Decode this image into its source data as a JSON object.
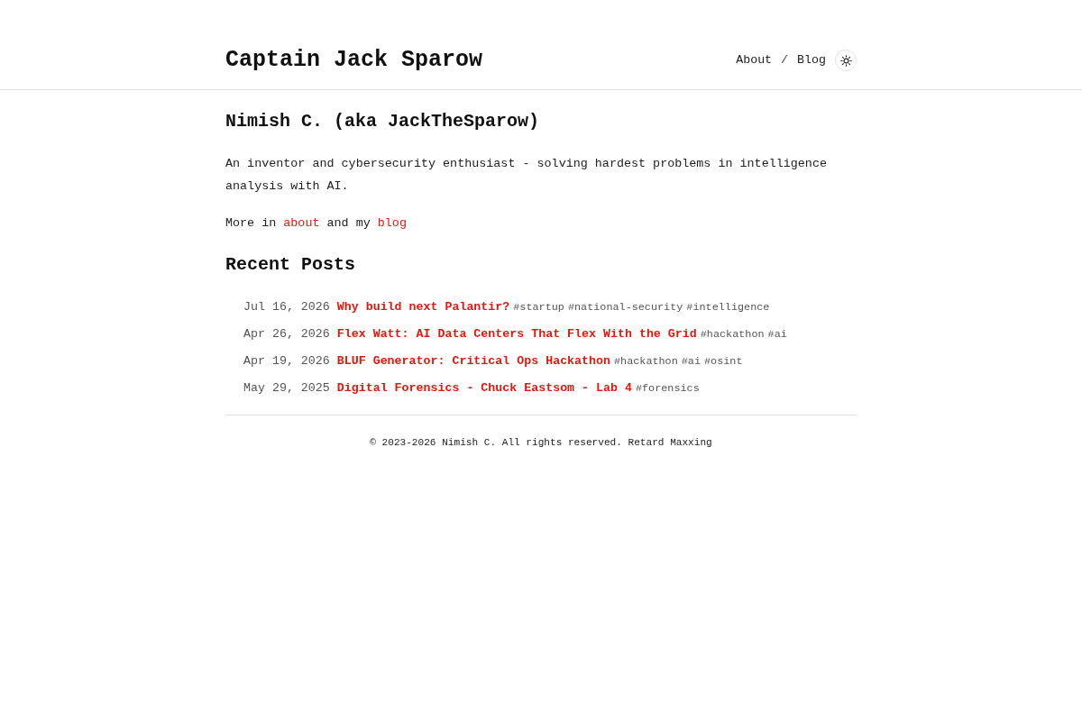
{
  "header": {
    "site_title": "Captain Jack Sparow",
    "nav": {
      "links": [
        "About",
        "Blog"
      ],
      "separator": "/"
    }
  },
  "intro": {
    "heading": "Nimish C. (aka JackTheSparow)",
    "bio": "An inventor and cybersecurity enthusiast - solving hardest problems in intelligence analysis with AI.",
    "more": [
      {
        "kind": "text",
        "text": "More in"
      },
      {
        "kind": "link",
        "text": "about"
      },
      {
        "kind": "text",
        "text": "and my"
      },
      {
        "kind": "link",
        "text": "blog"
      }
    ]
  },
  "recent_posts": {
    "heading": "Recent Posts",
    "posts": [
      {
        "date": "Jul 16, 2026",
        "title": "Why build next Palantir?",
        "tags": [
          "#startup",
          "#national-security",
          "#intelligence"
        ]
      },
      {
        "date": "Apr 26, 2026",
        "title": "Flex Watt: AI Data Centers That Flex With the Grid",
        "tags": [
          "#hackathon",
          "#ai"
        ]
      },
      {
        "date": "Apr 19, 2026",
        "title": "BLUF Generator: Critical Ops Hackathon",
        "tags": [
          "#hackathon",
          "#ai",
          "#osint"
        ]
      },
      {
        "date": "May 29, 2025",
        "title": "Digital Forensics - Chuck Eastsom - Lab 4",
        "tags": [
          "#forensics"
        ]
      }
    ]
  },
  "footer": {
    "text": "© 2023-2026 Nimish C. All rights reserved. Retard Maxxing"
  }
}
